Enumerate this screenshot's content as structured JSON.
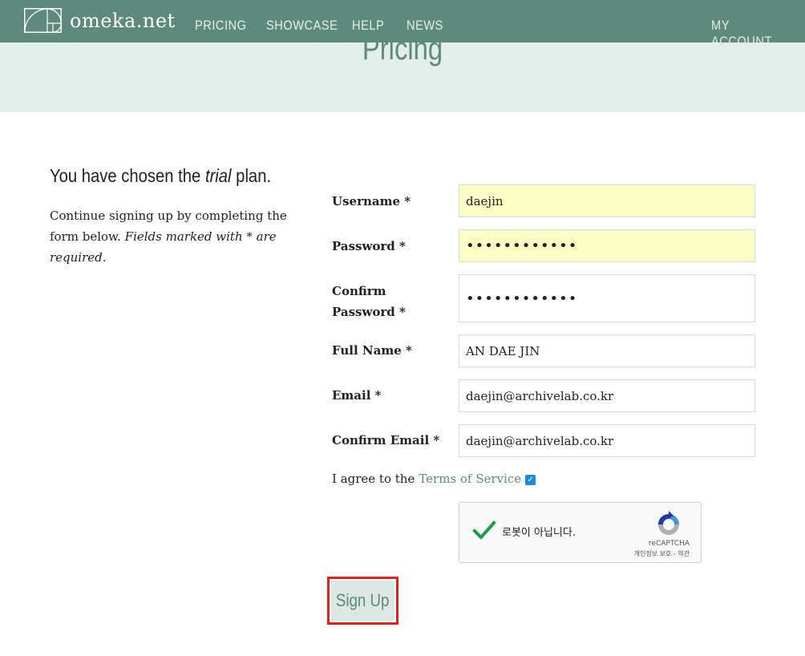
{
  "header": {
    "logo_text": "omeka.net",
    "nav": [
      "PRICING",
      "SHOWCASE",
      "HELP",
      "NEWS"
    ],
    "account": "MY ACCOUNT"
  },
  "hero": {
    "title": "Pricing"
  },
  "intro": {
    "heading_prefix": "You have chosen the ",
    "heading_plan": "trial",
    "heading_suffix": " plan.",
    "desc_plain": "Continue signing up by completing the form below. ",
    "desc_italic": "Fields marked with * are required."
  },
  "form": {
    "username_label": "Username  *",
    "username_value": "daejin",
    "password_label": "Password  *",
    "password_value": "••••••••••••",
    "confirm_password_label": "Confirm Password  *",
    "confirm_password_value": "••••••••••••",
    "full_name_label": "Full Name  *",
    "full_name_value": "AN DAE JIN",
    "email_label": "Email  *",
    "email_value": "daejin@archivelab.co.kr",
    "confirm_email_label": "Confirm Email  *",
    "confirm_email_value": "daejin@archivelab.co.kr",
    "agree_prefix": "I agree to the",
    "tos_link": "Terms of Service",
    "agree_checked": true,
    "signup_label": "Sign Up"
  },
  "captcha": {
    "text": "로봇이 아닙니다.",
    "brand": "reCAPTCHA",
    "links": "개인정보 보호 - 약관"
  },
  "colors": {
    "brand": "#5e8a7e",
    "hero_bg": "#e3edea",
    "autofill": "#fbfdc5",
    "highlight": "#e8201a"
  }
}
